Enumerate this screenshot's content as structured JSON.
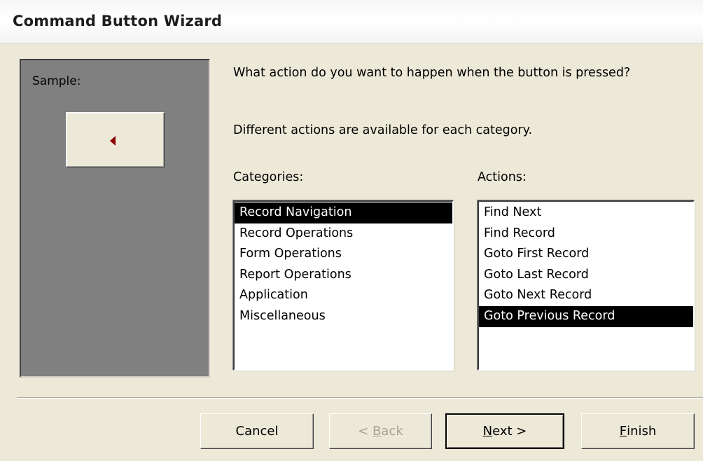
{
  "window": {
    "title": "Command Button Wizard"
  },
  "sample": {
    "label": "Sample:",
    "button_icon": "left-arrow-icon"
  },
  "prompt": {
    "question": "What action do you want to happen when the button is pressed?",
    "hint": "Different actions are available for each category."
  },
  "categories": {
    "label": "Categories:",
    "items": [
      "Record Navigation",
      "Record Operations",
      "Form Operations",
      "Report Operations",
      "Application",
      "Miscellaneous"
    ],
    "selected": "Record Navigation"
  },
  "actions": {
    "label": "Actions:",
    "items": [
      "Find Next",
      "Find Record",
      "Goto First Record",
      "Goto Last Record",
      "Goto Next Record",
      "Goto Previous Record"
    ],
    "selected": "Goto Previous Record"
  },
  "buttons": {
    "cancel": "Cancel",
    "back_prefix": "< ",
    "back_access": "B",
    "back_rest": "ack",
    "next_access": "N",
    "next_rest": "ext >",
    "finish_access": "F",
    "finish_rest": "inish",
    "back_enabled": false
  },
  "colors": {
    "selection_bg": "#000000",
    "selection_fg": "#ffffff",
    "sample_panel": "#808080",
    "arrow": "#8b0000"
  }
}
